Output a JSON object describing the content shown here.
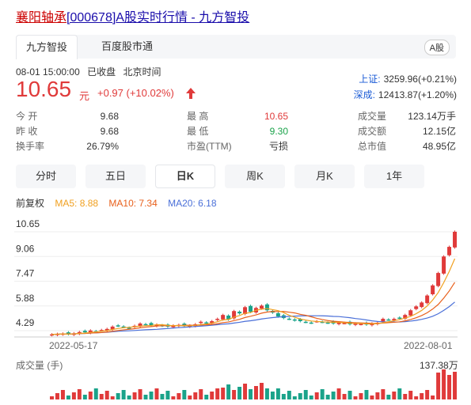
{
  "header": {
    "stock_name": "襄阳轴承",
    "code": "[000678]",
    "rest": "A股实时行情 - 九方智投"
  },
  "tabs": [
    {
      "label": "九方智投",
      "active": true
    },
    {
      "label": "百度股市通",
      "active": false
    }
  ],
  "market_tag": "A股",
  "status": {
    "date_time": "08-01 15:00:00",
    "state": "已收盘",
    "tz": "北京时间"
  },
  "price": {
    "last": "10.65",
    "unit": "元",
    "change": "+0.97 (+10.02%)",
    "direction": "up",
    "color": "#e03a3a"
  },
  "indices": [
    {
      "label": "上证:",
      "value": "3259.96(+0.21%)"
    },
    {
      "label": "深成:",
      "value": "12413.87(+1.20%)"
    }
  ],
  "stats": [
    [
      {
        "label": "今  开",
        "value": "9.68"
      },
      {
        "label": "最  高",
        "value": "10.65",
        "color": "#e03a3a"
      },
      {
        "label": "成交量",
        "value": "123.14万手"
      }
    ],
    [
      {
        "label": "昨  收",
        "value": "9.68"
      },
      {
        "label": "最  低",
        "value": "9.30",
        "color": "#1aa34a"
      },
      {
        "label": "成交额",
        "value": "12.15亿"
      }
    ],
    [
      {
        "label": "换手率",
        "value": "26.79%"
      },
      {
        "label": "市盈(TTM)",
        "value": "亏损"
      },
      {
        "label": "总市值",
        "value": "48.95亿"
      }
    ]
  ],
  "periods": [
    {
      "label": "分时",
      "active": false
    },
    {
      "label": "五日",
      "active": false
    },
    {
      "label": "日K",
      "active": true
    },
    {
      "label": "周K",
      "active": false
    },
    {
      "label": "月K",
      "active": false
    },
    {
      "label": "1年",
      "active": false
    }
  ],
  "ma": {
    "adjust": "前复权",
    "items": [
      {
        "label": "MA5: 8.88",
        "color": "#f0a020"
      },
      {
        "label": "MA10: 7.34",
        "color": "#e8601c"
      },
      {
        "label": "MA20: 6.18",
        "color": "#4a6fd8"
      }
    ]
  },
  "chart": {
    "y_ticks": [
      "10.65",
      "9.06",
      "7.47",
      "5.88",
      "4.29"
    ],
    "x_start": "2022-05-17",
    "x_end": "2022-08-01",
    "volume_label": "成交量 (手)",
    "volume_max": "137.38万",
    "up_color": "#e03a3a",
    "down_color": "#1aa38a"
  },
  "chart_data": {
    "type": "candlestick",
    "y_range": [
      4.29,
      10.65
    ],
    "candles_close": [
      4.05,
      4.08,
      4.1,
      4.06,
      4.12,
      4.2,
      4.18,
      4.3,
      4.25,
      4.33,
      4.4,
      4.55,
      4.6,
      4.52,
      4.45,
      4.6,
      4.75,
      4.7,
      4.62,
      4.68,
      4.6,
      4.55,
      4.62,
      4.66,
      4.58,
      4.62,
      4.7,
      4.86,
      4.8,
      4.9,
      5.05,
      5.3,
      5.0,
      5.55,
      5.4,
      5.8,
      5.5,
      5.75,
      5.9,
      5.6,
      5.45,
      5.2,
      5.1,
      5.05,
      4.95,
      4.9,
      4.85,
      4.8,
      4.9,
      4.85,
      4.8,
      4.75,
      4.82,
      4.78,
      4.7,
      4.75,
      4.72,
      4.68,
      4.75,
      4.8,
      5.05,
      5.0,
      5.05,
      5.1,
      5.3,
      5.6,
      5.85,
      6.1,
      6.55,
      7.2,
      8.0,
      9.06,
      9.68,
      10.65
    ],
    "volume_scale_max": 137.38
  }
}
